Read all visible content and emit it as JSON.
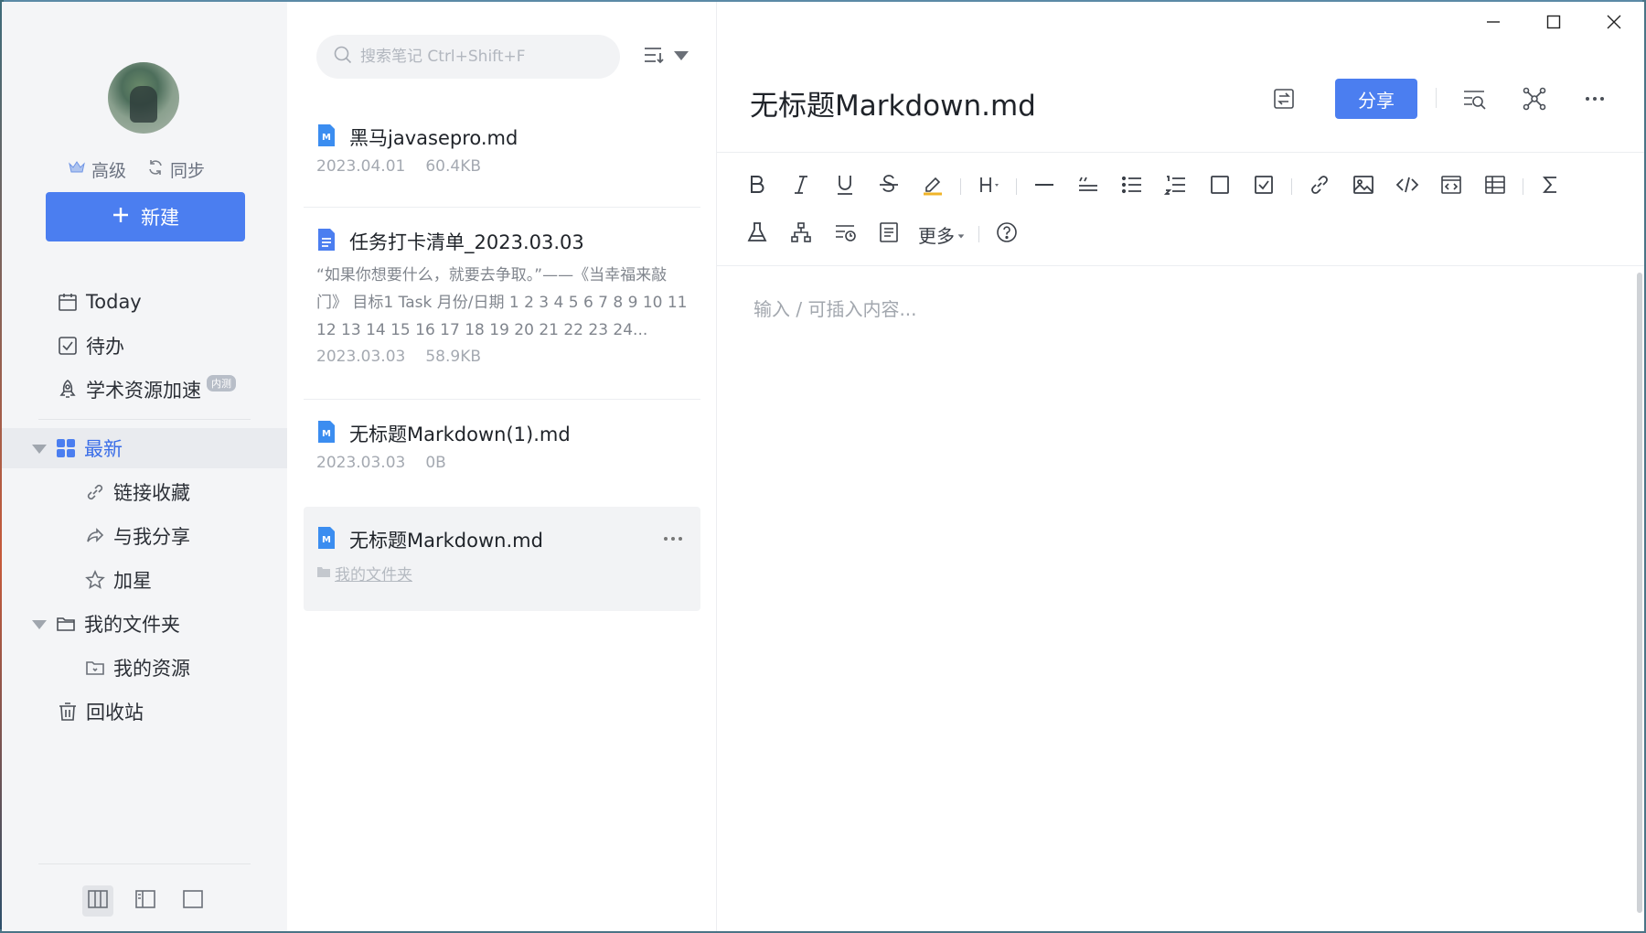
{
  "sidebar": {
    "account": {
      "level_label": "高级",
      "sync_label": "同步"
    },
    "new_button_label": "新建",
    "nav": [
      {
        "label": "Today"
      },
      {
        "label": "待办"
      },
      {
        "label": "学术资源加速",
        "badge": "内测"
      },
      {
        "label": "最新"
      },
      {
        "label": "链接收藏"
      },
      {
        "label": "与我分享"
      },
      {
        "label": "加星"
      },
      {
        "label": "我的文件夹"
      },
      {
        "label": "我的资源"
      },
      {
        "label": "回收站"
      }
    ]
  },
  "list": {
    "search_placeholder": "搜索笔记 Ctrl+Shift+F",
    "notes": [
      {
        "title": "黑马javasepro.md",
        "date": "2023.04.01",
        "size": "60.4KB"
      },
      {
        "title": "任务打卡清单_2023.03.03",
        "snippet": "“如果你想要什么，就要去争取。”——《当幸福来敲门》 目标1 Task 月份/日期 1 2 3 4 5 6 7 8 9 10 11 12 13 14 15 16 17 18 19 20 21 22 23 24...",
        "date": "2023.03.03",
        "size": "58.9KB"
      },
      {
        "title": "无标题Markdown(1).md",
        "date": "2023.03.03",
        "size": "0B"
      },
      {
        "title": "无标题Markdown.md",
        "folder": "我的文件夹"
      }
    ]
  },
  "editor": {
    "title": "无标题Markdown.md",
    "share_label": "分享",
    "more_label": "更多",
    "placeholder": "输入 / 可插入内容..."
  },
  "colors": {
    "accent": "#4b7ef0",
    "sidebar_bg": "#f4f5f7"
  }
}
